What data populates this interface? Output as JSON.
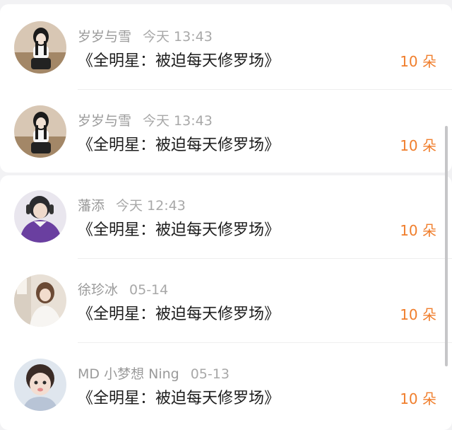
{
  "gifts": [
    {
      "name": "岁岁与雪",
      "time": "今天 13:43",
      "title": "《全明星：被迫每天修罗场》",
      "amount": "10 朵"
    },
    {
      "name": "岁岁与雪",
      "time": "今天 13:43",
      "title": "《全明星：被迫每天修罗场》",
      "amount": "10 朵"
    },
    {
      "name": "藩添",
      "time": "今天 12:43",
      "title": "《全明星：被迫每天修罗场》",
      "amount": "10 朵"
    },
    {
      "name": "徐珍冰",
      "time": "05-14",
      "title": "《全明星：被迫每天修罗场》",
      "amount": "10 朵"
    },
    {
      "name": "MD 小梦想 Ning",
      "time": "05-13",
      "title": "《全明星：被迫每天修罗场》",
      "amount": "10 朵"
    }
  ],
  "colors": {
    "amount": "#f07e2c",
    "name": "#9a9a9a",
    "title": "#1d1d1d"
  }
}
